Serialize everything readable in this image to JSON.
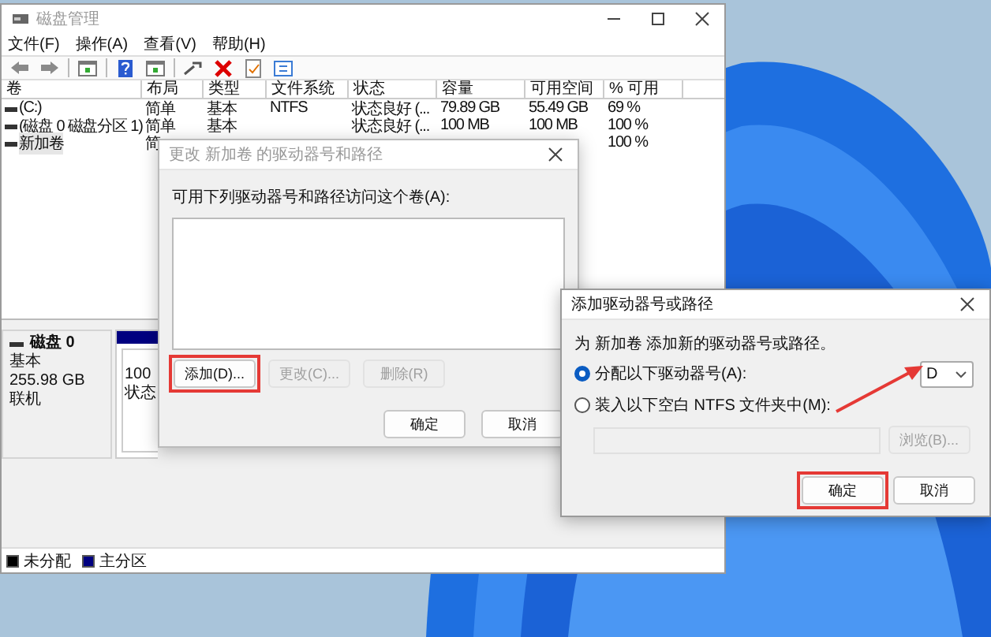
{
  "main_window": {
    "title": "磁盘管理",
    "active": false,
    "menu": [
      "文件(F)",
      "操作(A)",
      "查看(V)",
      "帮助(H)"
    ],
    "volume_table": {
      "columns": [
        "卷",
        "布局",
        "类型",
        "文件系统",
        "状态",
        "容量",
        "可用空间",
        "% 可用"
      ],
      "rows": [
        {
          "selected": false,
          "volume": "(C:)",
          "layout": "简单",
          "type": "基本",
          "file_system": "NTFS",
          "status": "状态良好 (...",
          "capacity": "79.89 GB",
          "free_space": "55.49 GB",
          "percent_free": "69 %"
        },
        {
          "selected": false,
          "volume": "(磁盘 0 磁盘分区 1)",
          "layout": "简单",
          "type": "基本",
          "status": "状态良好 (...",
          "capacity": "100 MB",
          "free_space": "100 MB",
          "percent_free": "100 %"
        },
        {
          "selected": true,
          "volume": "新加卷",
          "layout": "简",
          "percent_free": "100 %"
        }
      ]
    },
    "disks": [
      {
        "name": "磁盘 0",
        "type": "基本",
        "size": "255.98 GB",
        "status": "联机",
        "partitions": [
          {
            "color": "#000080",
            "lines": [
              "100",
              "状态"
            ]
          }
        ]
      }
    ],
    "legend": [
      {
        "label": "未分配",
        "color": "#000000"
      },
      {
        "label": "主分区",
        "color": "#000080"
      }
    ]
  },
  "drive_letter_dialog": {
    "title": "更改 新加卷 的驱动器号和路径",
    "active": false,
    "label": "可用下列驱动器号和路径访问这个卷(A):",
    "buttons": [
      {
        "label": "添加(D)...",
        "disabled": false,
        "highlighted": true
      },
      {
        "label": "更改(C)...",
        "disabled": true,
        "highlighted": false
      },
      {
        "label": "删除(R)",
        "disabled": true,
        "highlighted": false
      }
    ],
    "footer_buttons": [
      {
        "label": "确定",
        "disabled": false,
        "highlighted": false
      },
      {
        "label": "取消",
        "disabled": false,
        "highlighted": false
      }
    ]
  },
  "add_dialog": {
    "title": "添加驱动器号或路径",
    "active": true,
    "description": "为 新加卷 添加新的驱动器号或路径。",
    "options": [
      {
        "kind": "drive-letter",
        "label": "分配以下驱动器号(A):",
        "selected": true,
        "value": "D"
      },
      {
        "kind": "folder",
        "label": "装入以下空白 NTFS 文件夹中(M):",
        "selected": false
      }
    ],
    "browse_button": {
      "label": "浏览(B)...",
      "disabled": true,
      "highlighted": false
    },
    "footer_buttons": [
      {
        "label": "确定",
        "disabled": false,
        "highlighted": true
      },
      {
        "label": "取消",
        "disabled": false,
        "highlighted": false
      }
    ]
  }
}
